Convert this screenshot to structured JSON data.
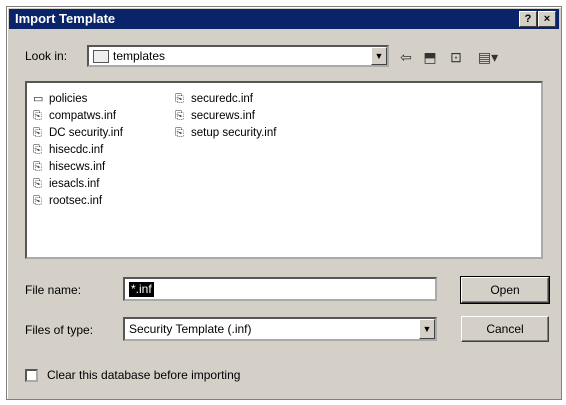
{
  "window": {
    "title": "Import Template",
    "help_label": "?",
    "close_label": "×"
  },
  "look_in": {
    "label": "Look in:",
    "value": "templates"
  },
  "files": {
    "column1": [
      {
        "name": "policies",
        "type": "folder"
      },
      {
        "name": "compatws.inf",
        "type": "inf"
      },
      {
        "name": "DC security.inf",
        "type": "inf"
      },
      {
        "name": "hisecdc.inf",
        "type": "inf"
      },
      {
        "name": "hisecws.inf",
        "type": "inf"
      },
      {
        "name": "iesacls.inf",
        "type": "inf"
      },
      {
        "name": "rootsec.inf",
        "type": "inf"
      }
    ],
    "column2": [
      {
        "name": "securedc.inf",
        "type": "inf"
      },
      {
        "name": "securews.inf",
        "type": "inf"
      },
      {
        "name": "setup security.inf",
        "type": "inf"
      }
    ]
  },
  "file_name": {
    "label": "File name:",
    "value": "*.inf"
  },
  "files_of_type": {
    "label": "Files of type:",
    "value": "Security Template (.inf)"
  },
  "buttons": {
    "open": "Open",
    "cancel": "Cancel"
  },
  "clear_db": {
    "label": "Clear this database before importing",
    "checked": false
  }
}
